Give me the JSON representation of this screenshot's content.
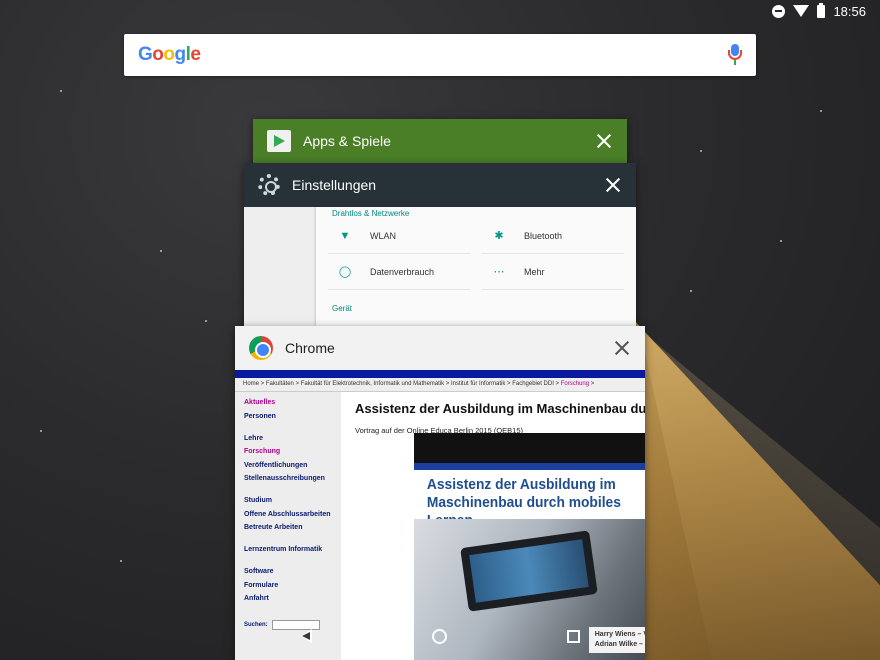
{
  "status_bar": {
    "time": "18:56"
  },
  "search": {
    "logo_letters": [
      "G",
      "o",
      "o",
      "g",
      "l",
      "e"
    ]
  },
  "recents": {
    "play_store": {
      "title": "Apps & Spiele"
    },
    "settings": {
      "title": "Einstellungen",
      "section_wireless": "Drahtlos & Netzwerke",
      "items": [
        {
          "icon": "wifi-icon",
          "label": "WLAN"
        },
        {
          "icon": "bluetooth-icon",
          "label": "Bluetooth"
        },
        {
          "icon": "data-usage-icon",
          "label": "Datenverbrauch"
        },
        {
          "icon": "more-icon",
          "label": "Mehr"
        }
      ],
      "section_device": "Gerät"
    },
    "chrome": {
      "title": "Chrome",
      "breadcrumb": [
        "Home",
        "Fakultäten",
        "Fakultät für Elektrotechnik, Informatik und Mathematik",
        "Institut für Informatik",
        "Fachgebiet DDI",
        "Forschung"
      ],
      "sidebar": {
        "group1": [
          "Aktuelles",
          "Personen"
        ],
        "group2": [
          "Lehre",
          "Forschung",
          "Veröffentlichungen",
          "Stellenausschreibungen"
        ],
        "group3": [
          "Studium",
          "Offene Abschlussarbeiten",
          "Betreute Arbeiten"
        ],
        "group4": [
          "Lernzentrum Informatik"
        ],
        "group5": [
          "Software",
          "Formulare",
          "Anfahrt"
        ],
        "search_label": "Suchen:"
      },
      "page_heading": "Assistenz der Ausbildung im Maschinenbau durch",
      "page_subtitle": "Vortrag auf der Online Educa Berlin 2015 (OEB15)",
      "promo_title_line1": "Assistenz der Ausbildung im",
      "promo_title_line2": "Maschinenbau durch mobiles Lernen",
      "promo_caption_line1": "Harry Wiens – V",
      "promo_caption_line2": "Adrian Wilke – "
    }
  },
  "colors": {
    "play_header": "#4a7f27",
    "settings_header": "#263238",
    "settings_accent": "#00897b",
    "chrome_link": "#0a1a6e",
    "chrome_link_active": "#b0008a"
  }
}
